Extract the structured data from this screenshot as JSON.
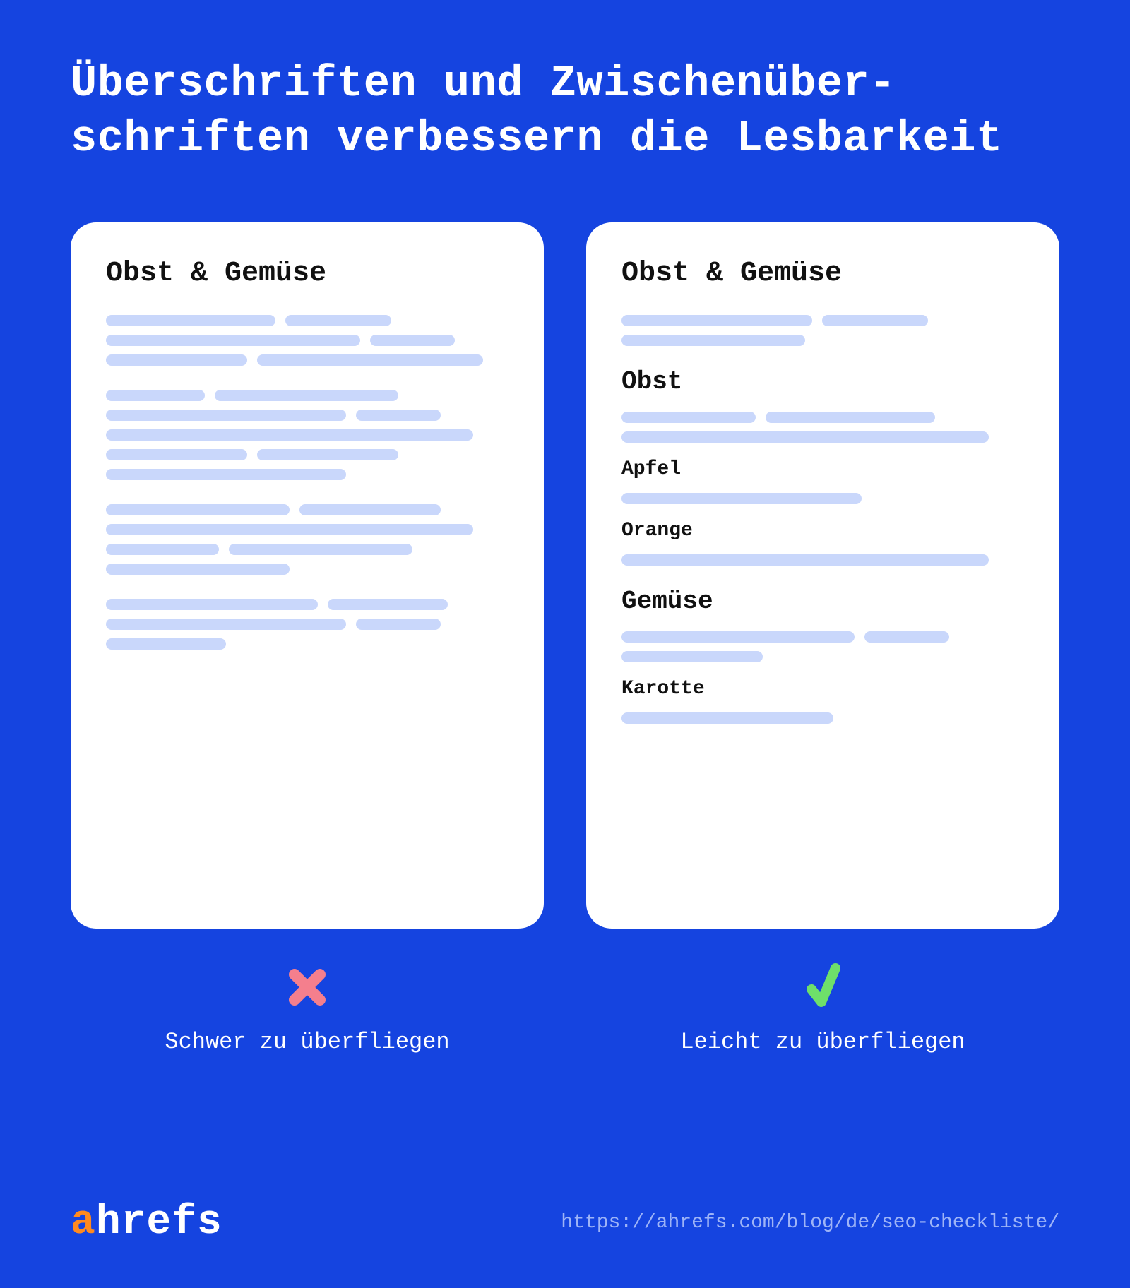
{
  "headline": "Überschriften und Zwischenüber-schriften verbessern die Lesbarkeit",
  "left": {
    "title": "Obst & Gemüse",
    "caption": "Schwer zu überfliegen"
  },
  "right": {
    "title": "Obst & Gemüse",
    "h2_1": "Obst",
    "h3_1": "Apfel",
    "h3_2": "Orange",
    "h2_2": "Gemüse",
    "h3_3": "Karotte",
    "caption": "Leicht zu überfliegen"
  },
  "logo": {
    "a": "a",
    "rest": "hrefs"
  },
  "source": "https://ahrefs.com/blog/de/seo-checkliste/"
}
